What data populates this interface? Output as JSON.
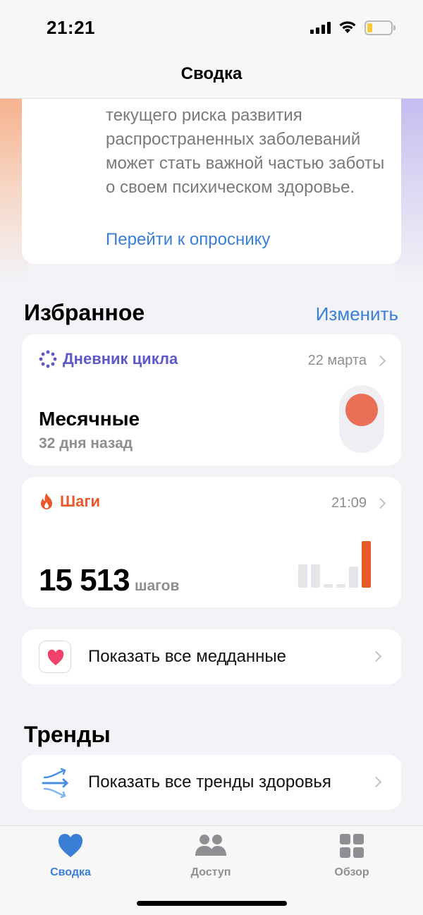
{
  "status_bar": {
    "time": "21:21"
  },
  "nav": {
    "title": "Сводка"
  },
  "intro_card": {
    "text": "текущего риска развития распространенных заболеваний может стать важной частью заботы о своем психическом здоровье.",
    "link": "Перейти к опроснику"
  },
  "favorites": {
    "title": "Избранное",
    "edit_label": "Изменить",
    "cycle": {
      "title": "Дневник цикла",
      "date": "22 марта",
      "value": "Месячные",
      "detail": "32 дня назад",
      "title_color": "#5e58c9",
      "dot_color": "#eb6f57"
    },
    "steps": {
      "title": "Шаги",
      "time": "21:09",
      "value": "15 513",
      "unit": "шагов",
      "title_color": "#e8582b",
      "bars": [
        0.5,
        0.5,
        0.08,
        0.08,
        0.45,
        1.0
      ]
    }
  },
  "health_data_row": {
    "label": "Показать все медданные",
    "icon": "heart-app-icon"
  },
  "trends": {
    "title": "Тренды",
    "row_label": "Показать все тренды здоровья",
    "icon": "trends-arrows-icon"
  },
  "tabbar": {
    "tabs": [
      {
        "label": "Сводка",
        "icon": "heart-icon",
        "active": true
      },
      {
        "label": "Доступ",
        "icon": "people-icon",
        "active": false
      },
      {
        "label": "Обзор",
        "icon": "grid-icon",
        "active": false
      }
    ],
    "active_color": "#3a7fd6",
    "inactive_color": "#8e8e93"
  }
}
